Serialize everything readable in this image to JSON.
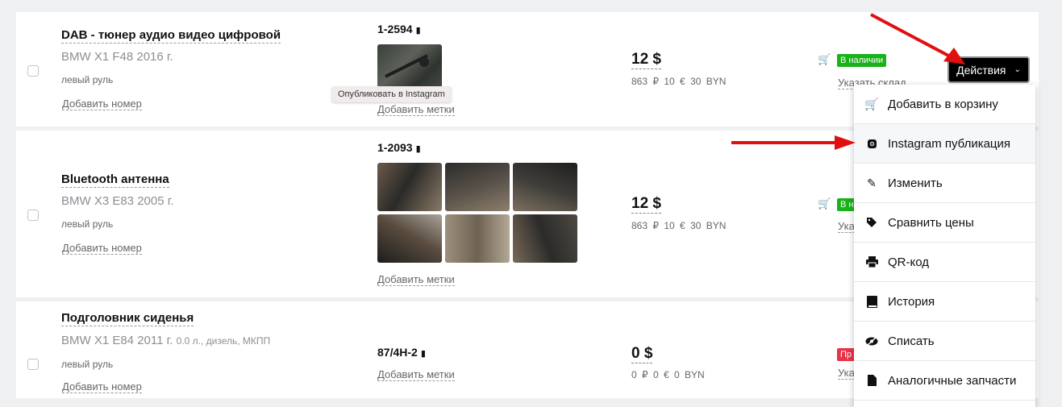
{
  "rows": [
    {
      "title": "DAB - тюнер аудио видео цифровой",
      "car": "BMW X1 F48 2016 г.",
      "car_extra": "",
      "wheel": "левый руль",
      "add_number": "Добавить номер",
      "sku": "1-2594",
      "add_tags": "Добавить метки",
      "price": "12 $",
      "conv": "863 ₽  10 €  30 BYN",
      "stock_badge": "В наличии",
      "stock_link": "Указать склад"
    },
    {
      "title": "Bluetooth антенна",
      "car": "BMW X3 E83 2005 г.",
      "car_extra": "",
      "wheel": "левый руль",
      "add_number": "Добавить номер",
      "sku": "1-2093",
      "add_tags": "Добавить метки",
      "price": "12 $",
      "conv": "863 ₽  10 €  30 BYN",
      "stock_badge": "В н",
      "stock_link": "Ука"
    },
    {
      "title": "Подголовник сиденья",
      "car": "BMW X1 E84 2011 г.",
      "car_extra": "0.0 л., дизель, МКПП",
      "wheel": "левый руль",
      "add_number": "Добавить номер",
      "sku": "87/4H-2",
      "add_tags": "Добавить метки",
      "price": "0 $",
      "conv": "0 ₽  0 €  0 BYN",
      "stock_badge": "Пр",
      "stock_link": "Ука"
    }
  ],
  "tooltip": "Опубликовать в Instagram",
  "actions_label": "Действия",
  "menu": [
    {
      "icon": "cart-icon",
      "label": "Добавить в корзину"
    },
    {
      "icon": "instagram-icon",
      "label": "Instagram публикация"
    },
    {
      "icon": "pencil-icon",
      "label": "Изменить"
    },
    {
      "icon": "tag-icon",
      "label": "Сравнить цены"
    },
    {
      "icon": "printer-icon",
      "label": "QR-код"
    },
    {
      "icon": "book-icon",
      "label": "История"
    },
    {
      "icon": "eye-slash-icon",
      "label": "Списать"
    },
    {
      "icon": "file-icon",
      "label": "Аналогичные запчасти"
    }
  ],
  "colors": {
    "in_stock": "#19b219",
    "sold": "#e8334a",
    "arrow": "#e01010"
  }
}
